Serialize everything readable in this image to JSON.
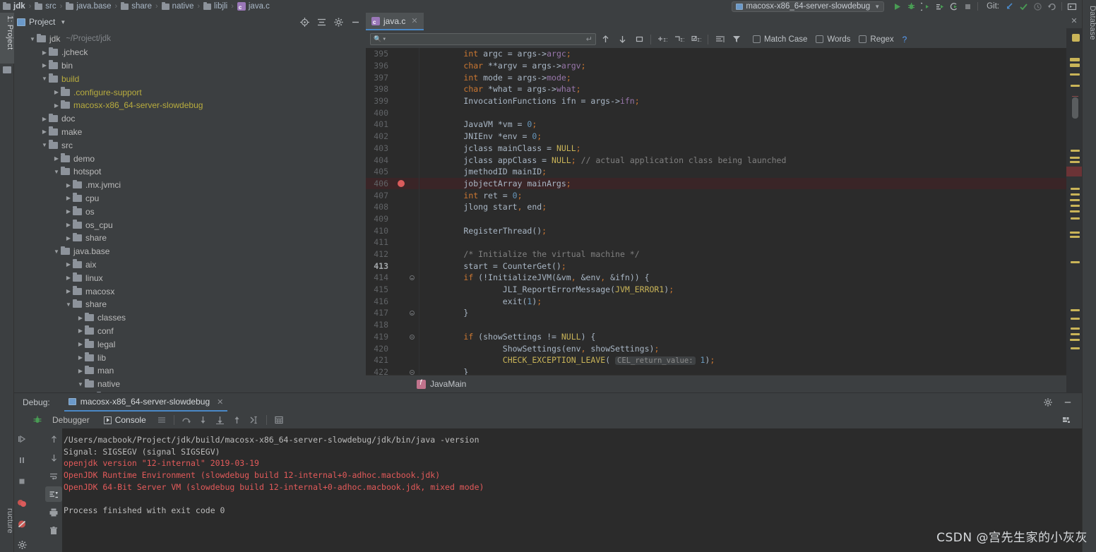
{
  "breadcrumb": {
    "items": [
      "jdk",
      "src",
      "java.base",
      "share",
      "native",
      "libjli"
    ],
    "file": "java.c"
  },
  "toolbar": {
    "run_config": "macosx-x86_64-server-slowdebug",
    "git_label": "Git:",
    "icons": [
      "run-icon",
      "debug-icon",
      "run-with-coverage-icon",
      "profile-icon",
      "attach-icon",
      "stop-icon",
      "update-project-icon",
      "commit-icon",
      "history-icon",
      "rollback-icon",
      "terminal-icon",
      "search-everywhere-icon"
    ]
  },
  "left_strip": {
    "project_tab": "1: Project",
    "structure_tab": "ructure"
  },
  "right_strip": {
    "database_tab": "Database"
  },
  "project_panel": {
    "title": "Project",
    "tools": [
      "locate-icon",
      "collapse-all-icon",
      "gear-icon",
      "minimize-icon"
    ],
    "tree": [
      {
        "depth": 0,
        "state": "open",
        "label": "jdk",
        "path": "~/Project/jdk",
        "excluded": false
      },
      {
        "depth": 1,
        "state": "closed",
        "label": ".jcheck",
        "path": "",
        "excluded": false
      },
      {
        "depth": 1,
        "state": "closed",
        "label": "bin",
        "path": "",
        "excluded": false
      },
      {
        "depth": 1,
        "state": "open",
        "label": "build",
        "path": "",
        "excluded": true
      },
      {
        "depth": 2,
        "state": "closed",
        "label": ".configure-support",
        "path": "",
        "excluded": true
      },
      {
        "depth": 2,
        "state": "closed",
        "label": "macosx-x86_64-server-slowdebug",
        "path": "",
        "excluded": true
      },
      {
        "depth": 1,
        "state": "closed",
        "label": "doc",
        "path": "",
        "excluded": false
      },
      {
        "depth": 1,
        "state": "closed",
        "label": "make",
        "path": "",
        "excluded": false
      },
      {
        "depth": 1,
        "state": "open",
        "label": "src",
        "path": "",
        "excluded": false
      },
      {
        "depth": 2,
        "state": "closed",
        "label": "demo",
        "path": "",
        "excluded": false
      },
      {
        "depth": 2,
        "state": "open",
        "label": "hotspot",
        "path": "",
        "excluded": false
      },
      {
        "depth": 3,
        "state": "closed",
        "label": ".mx.jvmci",
        "path": "",
        "excluded": false
      },
      {
        "depth": 3,
        "state": "closed",
        "label": "cpu",
        "path": "",
        "excluded": false
      },
      {
        "depth": 3,
        "state": "closed",
        "label": "os",
        "path": "",
        "excluded": false
      },
      {
        "depth": 3,
        "state": "closed",
        "label": "os_cpu",
        "path": "",
        "excluded": false
      },
      {
        "depth": 3,
        "state": "closed",
        "label": "share",
        "path": "",
        "excluded": false
      },
      {
        "depth": 2,
        "state": "open",
        "label": "java.base",
        "path": "",
        "excluded": false
      },
      {
        "depth": 3,
        "state": "closed",
        "label": "aix",
        "path": "",
        "excluded": false
      },
      {
        "depth": 3,
        "state": "closed",
        "label": "linux",
        "path": "",
        "excluded": false
      },
      {
        "depth": 3,
        "state": "closed",
        "label": "macosx",
        "path": "",
        "excluded": false
      },
      {
        "depth": 3,
        "state": "open",
        "label": "share",
        "path": "",
        "excluded": false
      },
      {
        "depth": 4,
        "state": "closed",
        "label": "classes",
        "path": "",
        "excluded": false
      },
      {
        "depth": 4,
        "state": "closed",
        "label": "conf",
        "path": "",
        "excluded": false
      },
      {
        "depth": 4,
        "state": "closed",
        "label": "legal",
        "path": "",
        "excluded": false
      },
      {
        "depth": 4,
        "state": "closed",
        "label": "lib",
        "path": "",
        "excluded": false
      },
      {
        "depth": 4,
        "state": "closed",
        "label": "man",
        "path": "",
        "excluded": false
      },
      {
        "depth": 4,
        "state": "open",
        "label": "native",
        "path": "",
        "excluded": false
      },
      {
        "depth": 5,
        "state": "closed",
        "label": "include",
        "path": "",
        "excluded": false
      }
    ]
  },
  "editor": {
    "tab_label": "java.c",
    "find": {
      "placeholder": "",
      "value": "",
      "match_case": "Match Case",
      "words": "Words",
      "regex": "Regex",
      "help": "?",
      "match_case_checked": false,
      "words_checked": false,
      "regex_checked": false
    },
    "breadcrumb_bottom": "JavaMain",
    "current_line": 413,
    "breakpoint_line": 406,
    "lines": [
      {
        "n": 395,
        "indent": 4,
        "html": "<span class=\"k\">int</span> argc = args-&gt;<span class=\"f\">argc</span><span class=\"k\">;</span>"
      },
      {
        "n": 396,
        "indent": 4,
        "html": "<span class=\"k\">char</span> **argv = args-&gt;<span class=\"f\">argv</span><span class=\"k\">;</span>"
      },
      {
        "n": 397,
        "indent": 4,
        "html": "<span class=\"k\">int</span> mode = args-&gt;<span class=\"f\">mode</span><span class=\"k\">;</span>"
      },
      {
        "n": 398,
        "indent": 4,
        "html": "<span class=\"k\">char</span> *what = args-&gt;<span class=\"f\">what</span><span class=\"k\">;</span>"
      },
      {
        "n": 399,
        "indent": 4,
        "html": "InvocationFunctions ifn = args-&gt;<span class=\"f\">ifn</span><span class=\"k\">;</span>"
      },
      {
        "n": 400,
        "indent": 0,
        "html": ""
      },
      {
        "n": 401,
        "indent": 4,
        "html": "JavaVM *vm = <span class=\"n\">0</span><span class=\"k\">;</span>"
      },
      {
        "n": 402,
        "indent": 4,
        "html": "JNIEnv *env = <span class=\"n\">0</span><span class=\"k\">;</span>"
      },
      {
        "n": 403,
        "indent": 4,
        "html": "jclass mainClass = <span class=\"m\">NULL</span><span class=\"k\">;</span>"
      },
      {
        "n": 404,
        "indent": 4,
        "html": "jclass appClass = <span class=\"m\">NULL</span><span class=\"k\">;</span> <span class=\"cm\">// actual application class being launched</span>"
      },
      {
        "n": 405,
        "indent": 4,
        "html": "jmethodID mainID<span class=\"k\">;</span>"
      },
      {
        "n": 406,
        "indent": 4,
        "html": "jobjectArray mainArgs<span class=\"k\">;</span>"
      },
      {
        "n": 407,
        "indent": 4,
        "html": "<span class=\"k\">int</span> ret = <span class=\"n\">0</span><span class=\"k\">;</span>"
      },
      {
        "n": 408,
        "indent": 4,
        "html": "jlong start<span class=\"k\">,</span> end<span class=\"k\">;</span>"
      },
      {
        "n": 409,
        "indent": 0,
        "html": ""
      },
      {
        "n": 410,
        "indent": 4,
        "html": "RegisterThread()<span class=\"k\">;</span>"
      },
      {
        "n": 411,
        "indent": 0,
        "html": ""
      },
      {
        "n": 412,
        "indent": 4,
        "html": "<span class=\"cm\">/* Initialize the virtual machine */</span>"
      },
      {
        "n": 413,
        "indent": 4,
        "html": "start = CounterGet()<span class=\"k\">;</span>"
      },
      {
        "n": 414,
        "indent": 4,
        "html": "<span class=\"k\">if</span> (!InitializeJVM(&amp;vm<span class=\"k\">,</span> &amp;env<span class=\"k\">,</span> &amp;ifn)) {"
      },
      {
        "n": 415,
        "indent": 8,
        "html": "JLI_ReportErrorMessage(<span class=\"m\">JVM_ERROR1</span>)<span class=\"k\">;</span>"
      },
      {
        "n": 416,
        "indent": 8,
        "html": "exit(<span class=\"n\">1</span>)<span class=\"k\">;</span>"
      },
      {
        "n": 417,
        "indent": 4,
        "html": "}"
      },
      {
        "n": 418,
        "indent": 0,
        "html": ""
      },
      {
        "n": 419,
        "indent": 4,
        "html": "<span class=\"k\">if</span> (showSettings != <span class=\"m\">NULL</span>) {"
      },
      {
        "n": 420,
        "indent": 8,
        "html": "ShowSettings(env<span class=\"k\">,</span> showSettings)<span class=\"k\">;</span>"
      },
      {
        "n": 421,
        "indent": 8,
        "html": "<span class=\"m\">CHECK_EXCEPTION_LEAVE</span>( <span class=\"hint\">CEL_return_value:</span> <span class=\"n\">1</span>)<span class=\"k\">;</span>"
      },
      {
        "n": 422,
        "indent": 4,
        "html": "}"
      }
    ],
    "fold_lines": [
      414,
      417,
      419,
      422
    ]
  },
  "debug": {
    "label": "Debug:",
    "session_tab": "macosx-x86_64-server-slowdebug",
    "tabs": [
      {
        "label": "Debugger",
        "active": false
      },
      {
        "label": "Console",
        "active": true
      }
    ],
    "left_icons": [
      "resume-icon",
      "pause-icon",
      "stop-icon",
      "view-breakpoints-icon",
      "mute-breakpoints-icon",
      "settings-icon"
    ],
    "console_icons": [
      "scroll-up-icon",
      "scroll-down-icon",
      "soft-wrap-icon",
      "scroll-to-end-icon",
      "print-icon",
      "clear-all-icon"
    ],
    "toolbar_icons": [
      "restore-layout-icon",
      "step-over-icon",
      "step-into-icon",
      "force-step-into-icon",
      "step-out-icon",
      "run-to-cursor-icon",
      "evaluate-icon"
    ],
    "header_right_icons": [
      "gear-icon",
      "minimize-icon"
    ],
    "settings_icon": "gear-icon",
    "console_output": [
      {
        "text": "/Users/macbook/Project/jdk/build/macosx-x86_64-server-slowdebug/jdk/bin/java -version",
        "color": "normal"
      },
      {
        "text": "Signal: SIGSEGV (signal SIGSEGV)",
        "color": "normal"
      },
      {
        "text": "openjdk version \"12-internal\" 2019-03-19",
        "color": "error"
      },
      {
        "text": "OpenJDK Runtime Environment (slowdebug build 12-internal+0-adhoc.macbook.jdk)",
        "color": "error"
      },
      {
        "text": "OpenJDK 64-Bit Server VM (slowdebug build 12-internal+0-adhoc.macbook.jdk, mixed mode)",
        "color": "error"
      },
      {
        "text": "",
        "color": "normal"
      },
      {
        "text": "Process finished with exit code 0",
        "color": "normal"
      }
    ]
  },
  "watermark": "CSDN @宫先生家的小灰灰",
  "colors": {
    "accent": "#4a88c7",
    "excluded_folder": "#b8ac3e",
    "error_text": "#e35a5a",
    "breakpoint": "#db5c5c",
    "keyword": "#cc7832",
    "field": "#9876aa",
    "number": "#6897bb",
    "macro": "#c9b458",
    "comment": "#808080"
  }
}
